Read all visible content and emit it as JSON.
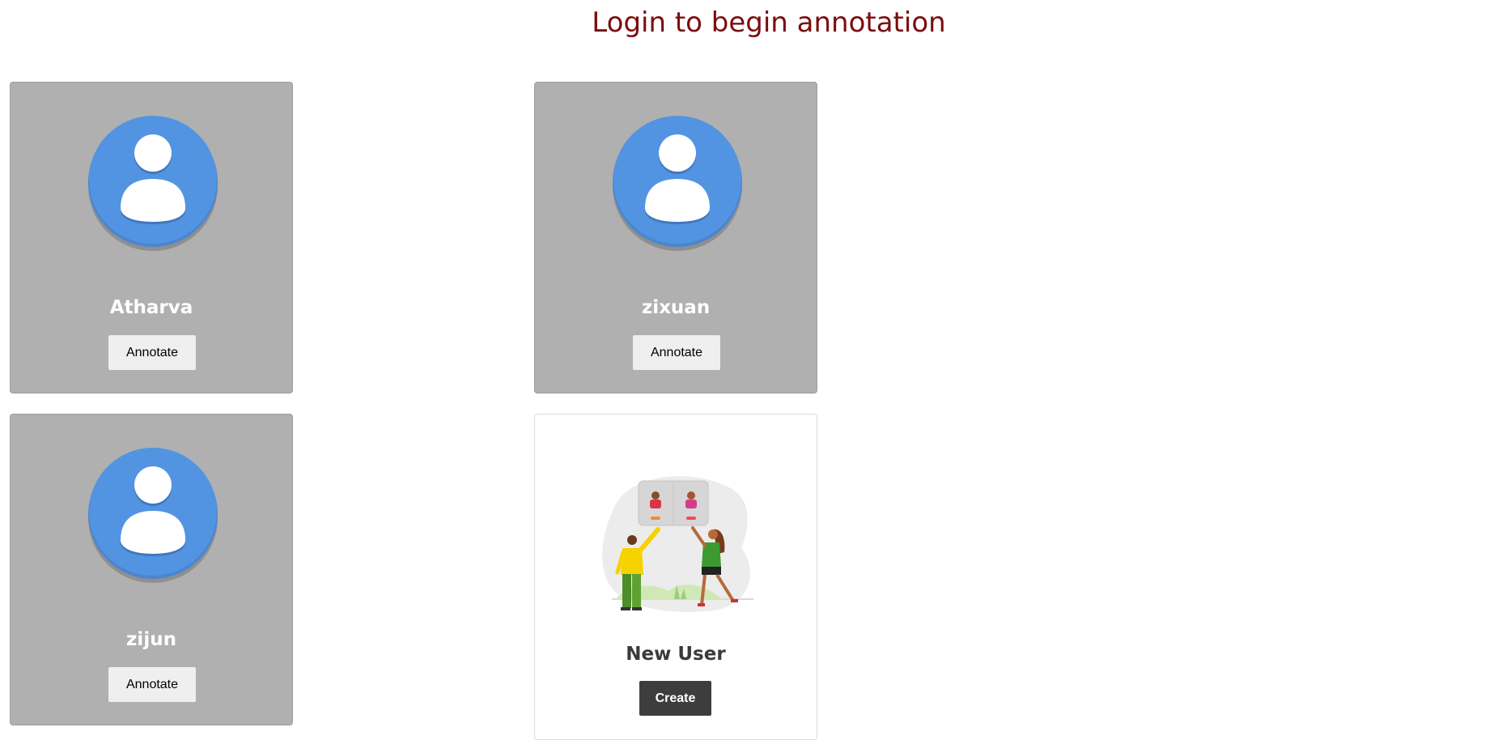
{
  "header": {
    "title": "Login to begin annotation"
  },
  "users": [
    {
      "name": "Atharva",
      "button_label": "Annotate"
    },
    {
      "name": "zixuan",
      "button_label": "Annotate"
    },
    {
      "name": "zijun",
      "button_label": "Annotate"
    }
  ],
  "new_user": {
    "label": "New User",
    "button_label": "Create"
  },
  "colors": {
    "title": "#7a0d0d",
    "card_background": "#b0b0b0",
    "avatar_blue": "#5294e2",
    "create_button": "#3d3d3d"
  },
  "icons": {
    "avatar": "account-circle-icon",
    "new_user_illustration": "people-collaboration-illustration"
  }
}
